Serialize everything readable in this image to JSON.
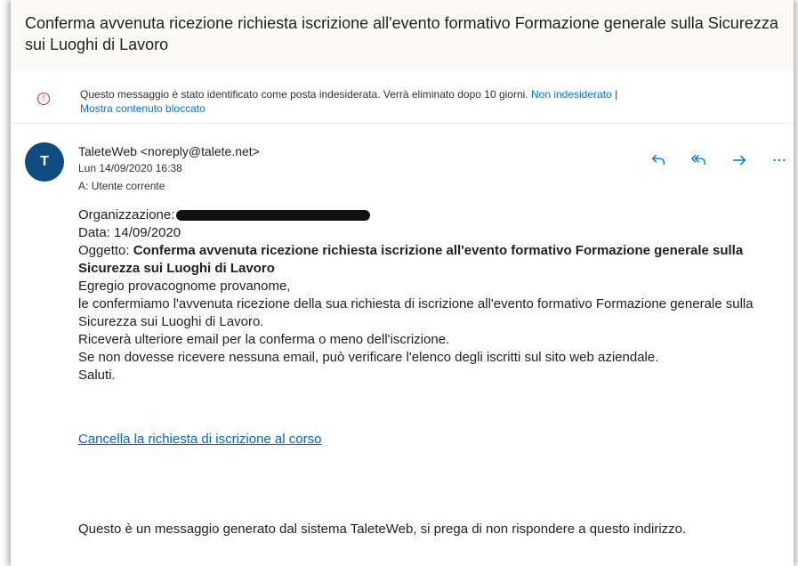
{
  "email": {
    "subject": "Conferma avvenuta ricezione richiesta iscrizione all'evento formativo Formazione generale sulla Sicurezza sui Luoghi di Lavoro",
    "junk_warning": {
      "text": "Questo messaggio è stato identificato come posta indesiderata. Verrà eliminato dopo 10 giorni.",
      "not_junk_link": "Non indesiderato",
      "separator": "|",
      "show_blocked_link": "Mostra contenuto bloccato",
      "icon": "warning-circle-icon",
      "color": "#d13438"
    },
    "sender": {
      "avatar_initial": "T",
      "avatar_color": "#0f4c81",
      "name_address": "TaleteWeb <noreply@talete.net>",
      "date": "Lun 14/09/2020 16:38",
      "to_label": "A:",
      "to_value": "Utente corrente"
    },
    "actions": [
      {
        "name": "reply-icon"
      },
      {
        "name": "reply-all-icon"
      },
      {
        "name": "forward-icon"
      },
      {
        "name": "more-icon"
      }
    ],
    "body": {
      "org_label": "Organizzazione:",
      "date_line": "Data: 14/09/2020",
      "subject_label": "Oggetto:",
      "subject_bold": "Conferma avvenuta ricezione richiesta iscrizione all'evento formativo Formazione generale sulla Sicurezza sui Luoghi di Lavoro",
      "greeting": "Egregio provacognome provanome,",
      "line1": "le confermiamo l'avvenuta ricezione della sua richiesta di iscrizione all'evento formativo Formazione generale sulla Sicurezza sui Luoghi di Lavoro.",
      "line2": "Riceverà ulteriore email per la conferma o meno dell'iscrizione.",
      "line3": "Se non dovesse ricevere nessuna email, può verificare l'elenco degli iscritti sul sito web aziendale.",
      "closing": "Saluti.",
      "cancel_link": "Cancella la richiesta di iscrizione al corso",
      "footer": "Questo è un messaggio generato dal sistema TaleteWeb, si prega di non rispondere a questo indirizzo."
    },
    "accent_color": "#0078d4"
  }
}
